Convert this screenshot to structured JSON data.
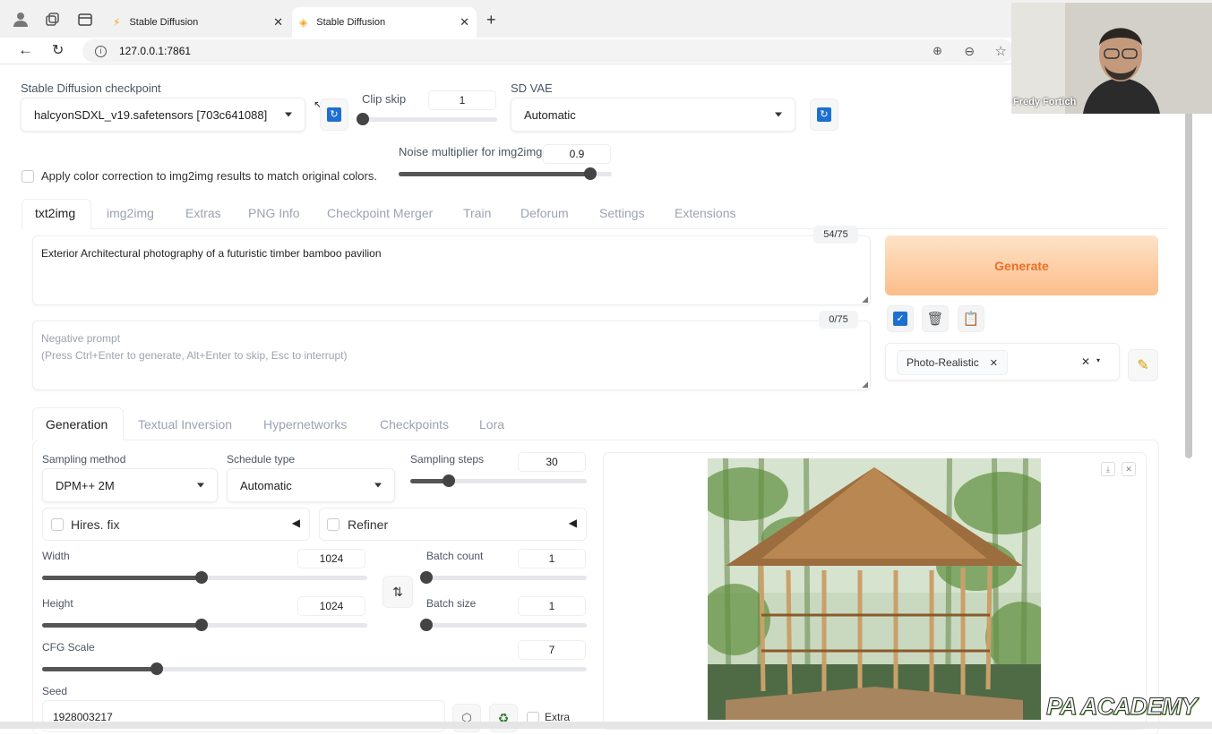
{
  "browser": {
    "tabs": [
      {
        "title": "Stable Diffusion"
      },
      {
        "title": "Stable Diffusion"
      }
    ],
    "url": "127.0.0.1:7861"
  },
  "top": {
    "checkpoint_label": "Stable Diffusion checkpoint",
    "checkpoint_value": "halcyonSDXL_v19.safetensors [703c641088]",
    "clip_skip_label": "Clip skip",
    "clip_skip_value": "1",
    "clip_skip_level": 0,
    "vae_label": "SD VAE",
    "vae_value": "Automatic",
    "noise_label": "Noise multiplier for img2img",
    "noise_value": "0.9",
    "noise_level": 0.9,
    "color_correction_label": "Apply color correction to img2img results to match original colors."
  },
  "main_tabs": [
    "txt2img",
    "img2img",
    "Extras",
    "PNG Info",
    "Checkpoint Merger",
    "Train",
    "Deforum",
    "Settings",
    "Extensions"
  ],
  "prompt": {
    "text": "Exterior Architectural photography of a futuristic timber bamboo pavilion",
    "counter": "54/75",
    "negative_placeholder_1": "Negative prompt",
    "negative_placeholder_2": "(Press Ctrl+Enter to generate, Alt+Enter to skip, Esc to interrupt)",
    "negative_counter": "0/75"
  },
  "generate": {
    "label": "Generate",
    "style_chip": "Photo-Realistic"
  },
  "sub_tabs": [
    "Generation",
    "Textual Inversion",
    "Hypernetworks",
    "Checkpoints",
    "Lora"
  ],
  "generation": {
    "sampling_method_label": "Sampling method",
    "sampling_method_value": "DPM++ 2M",
    "schedule_type_label": "Schedule type",
    "schedule_type_value": "Automatic",
    "sampling_steps_label": "Sampling steps",
    "sampling_steps_value": "30",
    "sampling_steps_level": 0.22,
    "hires_label": "Hires. fix",
    "refiner_label": "Refiner",
    "width_label": "Width",
    "width_value": "1024",
    "width_level": 0.49,
    "height_label": "Height",
    "height_value": "1024",
    "height_level": 0.49,
    "batch_count_label": "Batch count",
    "batch_count_value": "1",
    "batch_count_level": 0,
    "batch_size_label": "Batch size",
    "batch_size_value": "1",
    "batch_size_level": 0,
    "cfg_label": "CFG Scale",
    "cfg_value": "7",
    "cfg_level": 0.21,
    "seed_label": "Seed",
    "seed_value": "1928003217",
    "extra_label": "Extra"
  },
  "webcam": {
    "name": "Fredy Fortich"
  },
  "watermark": {
    "text": "PA ACADEMY"
  },
  "colors": {
    "generate_gradient_start": "#fde3c8",
    "generate_gradient_end": "#fdbd8a",
    "generate_text": "#e8702a",
    "accent_blue": "#1d6fd1"
  }
}
